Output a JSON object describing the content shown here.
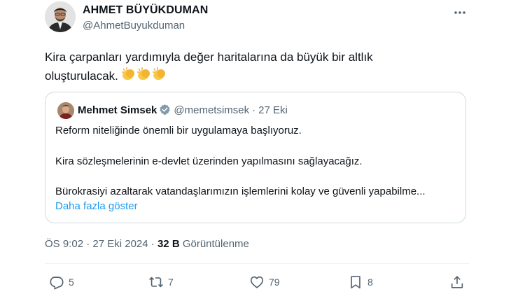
{
  "author": {
    "name": "AHMET BÜYÜKDUMAN",
    "handle": "@AhmetBuyukduman"
  },
  "tweet": {
    "line1": "Kira çarpanları yardımıyla değer haritalarına da büyük bir altlık",
    "line2": "oluşturulacak.",
    "emoji": "clapping-hands x3"
  },
  "quote": {
    "name": "Mehmet Simsek",
    "handle": "@memetsimsek",
    "separator": "·",
    "date": "27 Eki",
    "lines": [
      "Reform niteliğinde önemli bir uygulamaya başlıyoruz.",
      "Kira sözleşmelerinin e-devlet üzerinden yapılmasını sağlayacağız.",
      "Bürokrasiyi azaltarak vatandaşlarımızın işlemlerini kolay ve güvenli yapabilme..."
    ],
    "show_more": "Daha fazla göster"
  },
  "meta": {
    "time": "ÖS 9:02",
    "separator": "·",
    "date": "27 Eki 2024",
    "views_count": "32 B",
    "views_label": "Görüntülenme"
  },
  "actions": {
    "replies": "5",
    "reposts": "7",
    "likes": "79",
    "bookmarks": "8"
  },
  "colors": {
    "text": "#0f1419",
    "secondary": "#536471",
    "link": "#1d9bf0",
    "border": "#cfd9de",
    "verified": "#829aab"
  },
  "icons": [
    "more-icon",
    "verified-badge-icon",
    "reply-icon",
    "repost-icon",
    "like-icon",
    "bookmark-icon",
    "share-icon"
  ]
}
